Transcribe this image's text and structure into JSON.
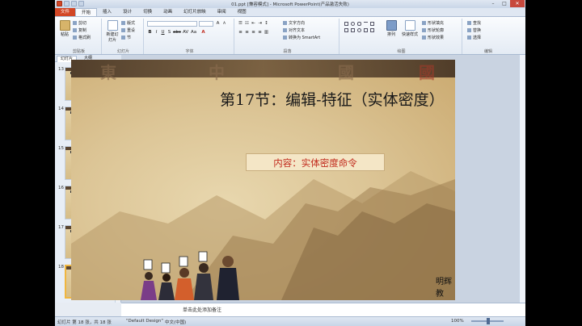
{
  "window": {
    "title": "01.ppt [兼容模式] - Microsoft PowerPoint(产品激活失败)"
  },
  "tabs": [
    {
      "label": "文件",
      "kind": "file"
    },
    {
      "label": "开始",
      "kind": "active"
    },
    {
      "label": "插入",
      "kind": "normal"
    },
    {
      "label": "设计",
      "kind": "normal"
    },
    {
      "label": "切换",
      "kind": "normal"
    },
    {
      "label": "动画",
      "kind": "normal"
    },
    {
      "label": "幻灯片放映",
      "kind": "normal"
    },
    {
      "label": "审阅",
      "kind": "normal"
    },
    {
      "label": "视图",
      "kind": "normal"
    }
  ],
  "ribbon": {
    "paste": "粘贴",
    "cut": "剪切",
    "copy": "复制",
    "format_painter": "格式刷",
    "clipboard": "剪贴板",
    "new_slide": "新建幻灯片",
    "layout": "版式",
    "reset": "重设",
    "section": "节",
    "slides": "幻灯片",
    "font": "字体",
    "paragraph": "段落",
    "text_direction": "文字方向",
    "align_text": "对齐文本",
    "smartart": "转换为 SmartArt",
    "arrange": "排列",
    "quick_styles": "快速样式",
    "shape_fill": "形状填充",
    "shape_outline": "形状轮廓",
    "shape_effects": "形状效果",
    "drawing": "绘图",
    "find": "查找",
    "replace": "替换",
    "select": "选择",
    "editing": "编辑"
  },
  "panel": {
    "tab_slides": "幻灯片",
    "tab_outline": "大纲",
    "thumbnails": [
      {
        "num": "13",
        "selected": false
      },
      {
        "num": "14",
        "selected": false
      },
      {
        "num": "15",
        "selected": false
      },
      {
        "num": "16",
        "selected": false
      },
      {
        "num": "17",
        "selected": false
      },
      {
        "num": "18",
        "selected": true
      }
    ]
  },
  "slide": {
    "calligraphy": [
      "東",
      "中",
      "國",
      "國"
    ],
    "title": "第17节：编辑-特征（实体密度）",
    "content": "内容：实体密度命令",
    "author": "明辉教育：青杨"
  },
  "notes": {
    "placeholder": "单击此处添加备注"
  },
  "status": {
    "slide_info": "幻灯片 第 18 张，共 18 张",
    "theme": "\"Default Design\"",
    "language": "中文(中国)",
    "zoom": "100%"
  }
}
